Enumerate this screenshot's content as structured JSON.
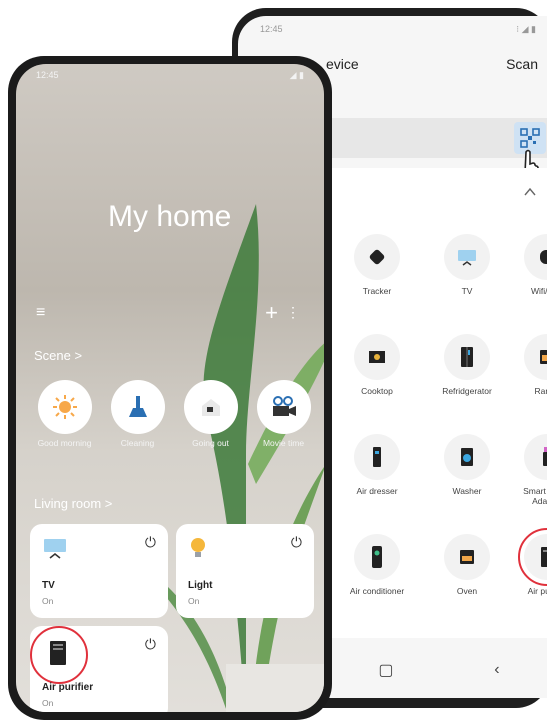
{
  "back_phone": {
    "status_time": "12:45",
    "status_icons": "⁝ ◢ ▮",
    "header_title": "evice",
    "scan_label": "Scan",
    "categories": [
      {
        "label": "Tracker",
        "icon": "tracker-icon"
      },
      {
        "label": "TV",
        "icon": "tv-icon"
      },
      {
        "label": "Wifi/Hub",
        "icon": "wifi-hub-icon"
      },
      {
        "label": "Cooktop",
        "icon": "cooktop-icon"
      },
      {
        "label": "Refridgerator",
        "icon": "refrigerator-icon"
      },
      {
        "label": "Range",
        "icon": "range-icon"
      },
      {
        "label": "Air dresser",
        "icon": "air-dresser-icon"
      },
      {
        "label": "Washer",
        "icon": "washer-icon"
      },
      {
        "label": "Smart Home Adapter",
        "icon": "smart-home-adapter-icon"
      },
      {
        "label": "Air conditioner",
        "icon": "air-conditioner-icon"
      },
      {
        "label": "Oven",
        "icon": "oven-icon"
      },
      {
        "label": "Air purifier",
        "icon": "air-purifier-icon"
      }
    ],
    "nav": {
      "home": "▢",
      "back": "‹"
    }
  },
  "front_phone": {
    "status_time": "12:45",
    "status_icons": "◢ ▮",
    "title": "My home",
    "scene_label": "Scene  >",
    "scenes": [
      {
        "label": "Good morning",
        "icon": "sun-icon"
      },
      {
        "label": "Cleaning",
        "icon": "broom-icon"
      },
      {
        "label": "Going out",
        "icon": "house-icon"
      },
      {
        "label": "Movie time",
        "icon": "movie-camera-icon"
      }
    ],
    "room_label": "Living room  >",
    "devices": [
      {
        "name": "TV",
        "status": "On",
        "icon": "tv-icon"
      },
      {
        "name": "Light",
        "status": "On",
        "icon": "bulb-icon"
      },
      {
        "name": "Air purifier",
        "status": "On",
        "icon": "air-purifier-icon"
      }
    ],
    "menu_icon": "≡",
    "plus_icon": "+",
    "more_icon": "⋮",
    "power_icon": "⏻"
  },
  "colors": {
    "highlight_ring": "#e0313c",
    "qr_button_bg": "#cfe2f4",
    "sun": "#f7a84a",
    "broom": "#2a6fb3"
  }
}
